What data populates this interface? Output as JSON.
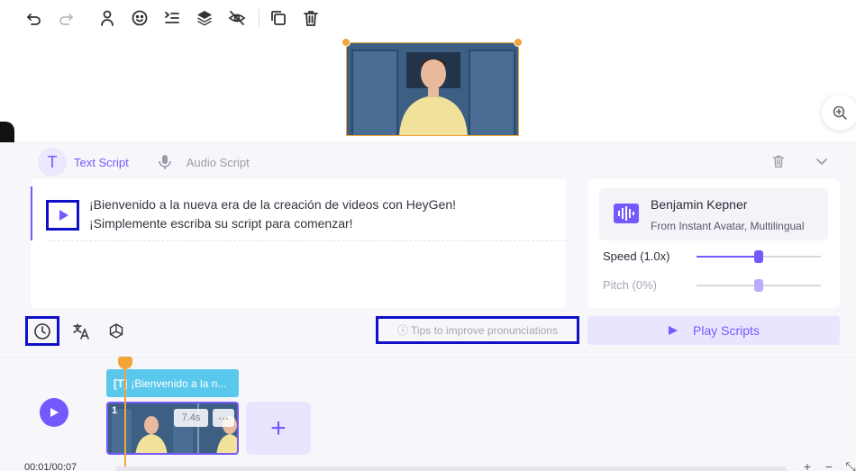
{
  "toolbar": {
    "icons": [
      "undo-icon",
      "redo-icon",
      "avatar-icon",
      "face-icon",
      "list-icon",
      "layers-icon",
      "hide-icon",
      "duplicate-icon",
      "trash-icon"
    ]
  },
  "script": {
    "tabs": [
      {
        "label": "Text Script",
        "active": true
      },
      {
        "label": "Audio Script",
        "active": false
      }
    ],
    "line1": "¡Bienvenido a la nueva era de la creación de videos con HeyGen!",
    "line2": "¡Simplemente escriba su script para comenzar!",
    "tips": "Tips to improve pronunciations"
  },
  "voice": {
    "name": "Benjamin Kepner",
    "subtitle": "From Instant Avatar, Multilingual",
    "speed_label": "Speed (1.0x)",
    "speed_value": 1.0,
    "pitch_label": "Pitch (0%)",
    "pitch_value": 0
  },
  "play_scripts_label": "Play Scripts",
  "timeline": {
    "text_clip_label": "¡Bienvenido a la n...",
    "clip_number": "1",
    "clip_duration": "7.4s",
    "clip_more": "···",
    "add_label": "+",
    "time": "00:01/00:07",
    "zoom_in": "+",
    "zoom_out": "−"
  },
  "colors": {
    "accent": "#7559ff",
    "playhead": "#f3a53a",
    "highlight_box": "#1010c8",
    "text_clip": "#5ac8ec"
  }
}
